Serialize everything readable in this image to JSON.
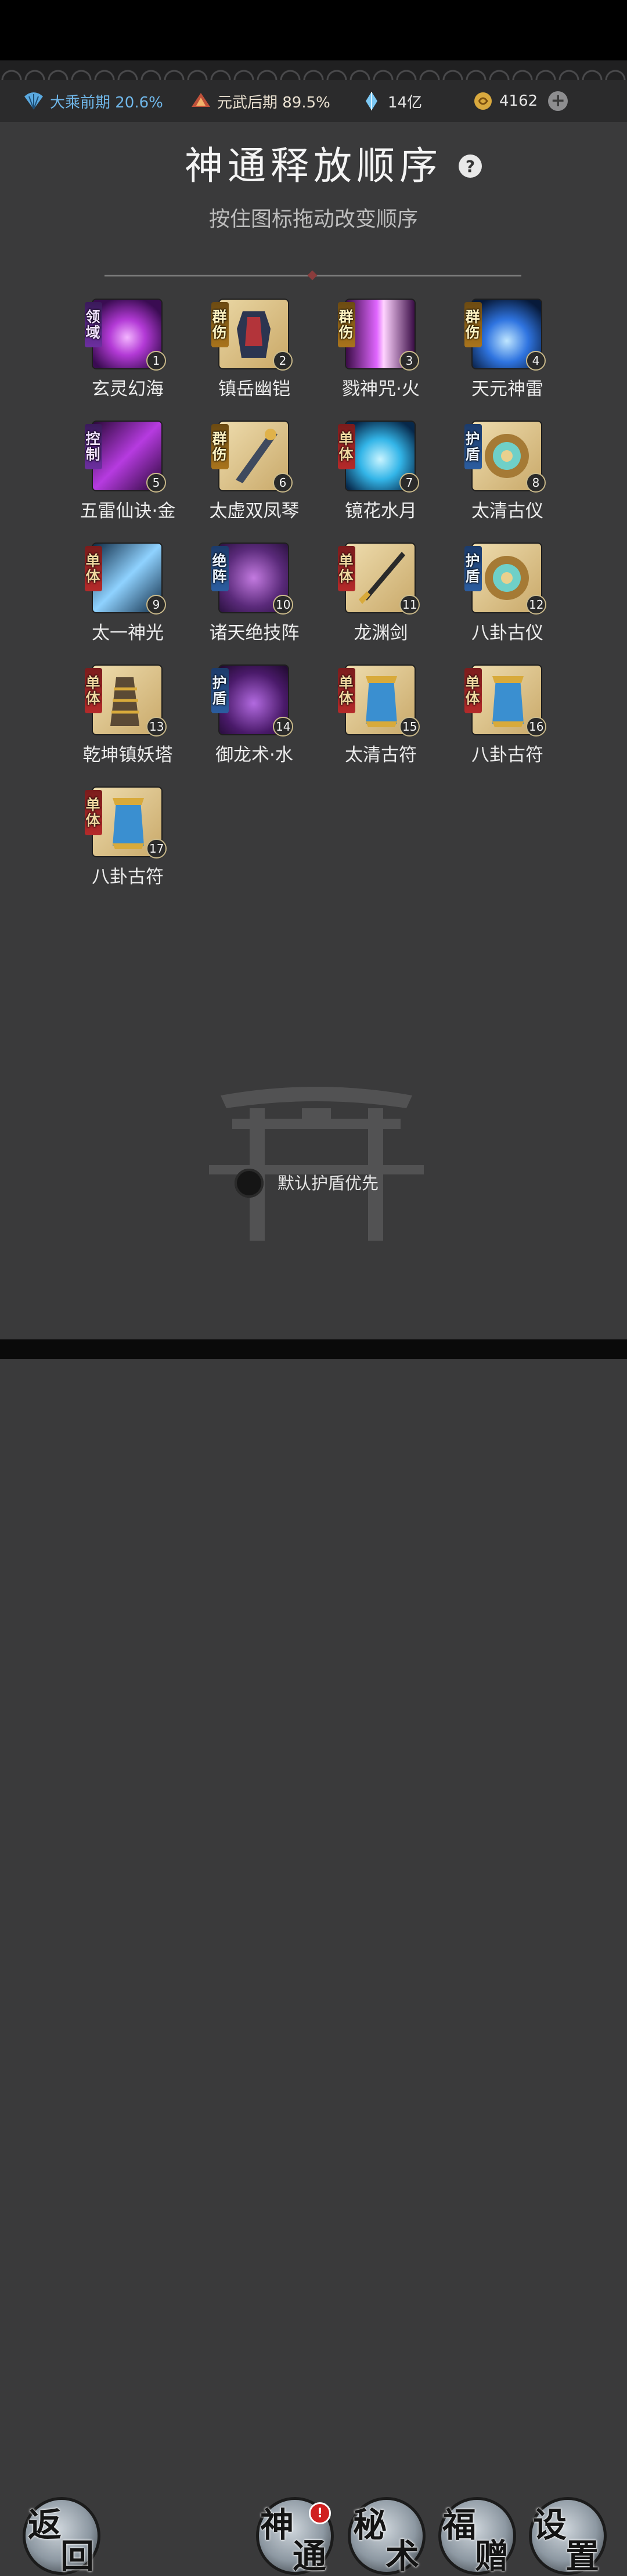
{
  "resources": {
    "realm1": {
      "text": "大乘前期 20.6%",
      "color": "#6fb6e8",
      "icon": "fan-icon"
    },
    "realm2": {
      "text": "元武后期 89.5%",
      "color": "#e9e0d0",
      "icon": "martial-realm-icon"
    },
    "crystal": {
      "text": "14亿",
      "icon": "spirit-crystal-icon"
    },
    "coins": {
      "text": "4162",
      "icon": "coin-icon"
    },
    "add": "+"
  },
  "header": {
    "title": "神通释放顺序",
    "help": "?",
    "subtitle": "按住图标拖动改变顺序"
  },
  "skills": [
    {
      "order": "1",
      "name": "玄灵幻海",
      "tag": "领域",
      "tagStyle": "purple",
      "icon": "purple-vortex-icon"
    },
    {
      "order": "2",
      "name": "镇岳幽铠",
      "tag": "群伤",
      "tagStyle": "gold",
      "icon": "dark-armor-icon"
    },
    {
      "order": "3",
      "name": "戮神咒·火",
      "tag": "群伤",
      "tagStyle": "gold",
      "icon": "pink-beam-icon"
    },
    {
      "order": "4",
      "name": "天元神雷",
      "tag": "群伤",
      "tagStyle": "gold",
      "icon": "blue-lightning-icon"
    },
    {
      "order": "5",
      "name": "五雷仙诀·金",
      "tag": "控制",
      "tagStyle": "purple",
      "icon": "purple-thunder-icon"
    },
    {
      "order": "6",
      "name": "太虚双凤琴",
      "tag": "群伤",
      "tagStyle": "gold",
      "icon": "phoenix-zither-icon"
    },
    {
      "order": "7",
      "name": "镜花水月",
      "tag": "单体",
      "tagStyle": "red",
      "icon": "water-lotus-icon"
    },
    {
      "order": "8",
      "name": "太清古仪",
      "tag": "护盾",
      "tagStyle": "blue",
      "icon": "bagua-compass-icon"
    },
    {
      "order": "9",
      "name": "太一神光",
      "tag": "单体",
      "tagStyle": "red",
      "icon": "light-beam-icon"
    },
    {
      "order": "10",
      "name": "诸天绝技阵",
      "tag": "绝阵",
      "tagStyle": "blue",
      "icon": "orb-array-icon"
    },
    {
      "order": "11",
      "name": "龙渊剑",
      "tag": "单体",
      "tagStyle": "red",
      "icon": "dragon-sword-icon"
    },
    {
      "order": "12",
      "name": "八卦古仪",
      "tag": "护盾",
      "tagStyle": "blue",
      "icon": "bagua-compass-icon"
    },
    {
      "order": "13",
      "name": "乾坤镇妖塔",
      "tag": "单体",
      "tagStyle": "red",
      "icon": "demon-tower-icon"
    },
    {
      "order": "14",
      "name": "御龙术·水",
      "tag": "护盾",
      "tagStyle": "blue",
      "icon": "demon-mask-icon"
    },
    {
      "order": "15",
      "name": "太清古符",
      "tag": "单体",
      "tagStyle": "red",
      "icon": "talisman-scroll-icon"
    },
    {
      "order": "16",
      "name": "八卦古符",
      "tag": "单体",
      "tagStyle": "red",
      "icon": "talisman-scroll-icon"
    },
    {
      "order": "17",
      "name": "八卦古符",
      "tag": "单体",
      "tagStyle": "red",
      "icon": "talisman-scroll-icon"
    }
  ],
  "shield_priority": {
    "label": "默认护盾优先",
    "enabled": false
  },
  "nav": {
    "back": [
      "返",
      "回"
    ],
    "divine": [
      "神",
      "通"
    ],
    "secret": [
      "秘",
      "术"
    ],
    "gift": [
      "福",
      "赠"
    ],
    "settings": [
      "设",
      "置"
    ],
    "divine_badge": "!"
  }
}
